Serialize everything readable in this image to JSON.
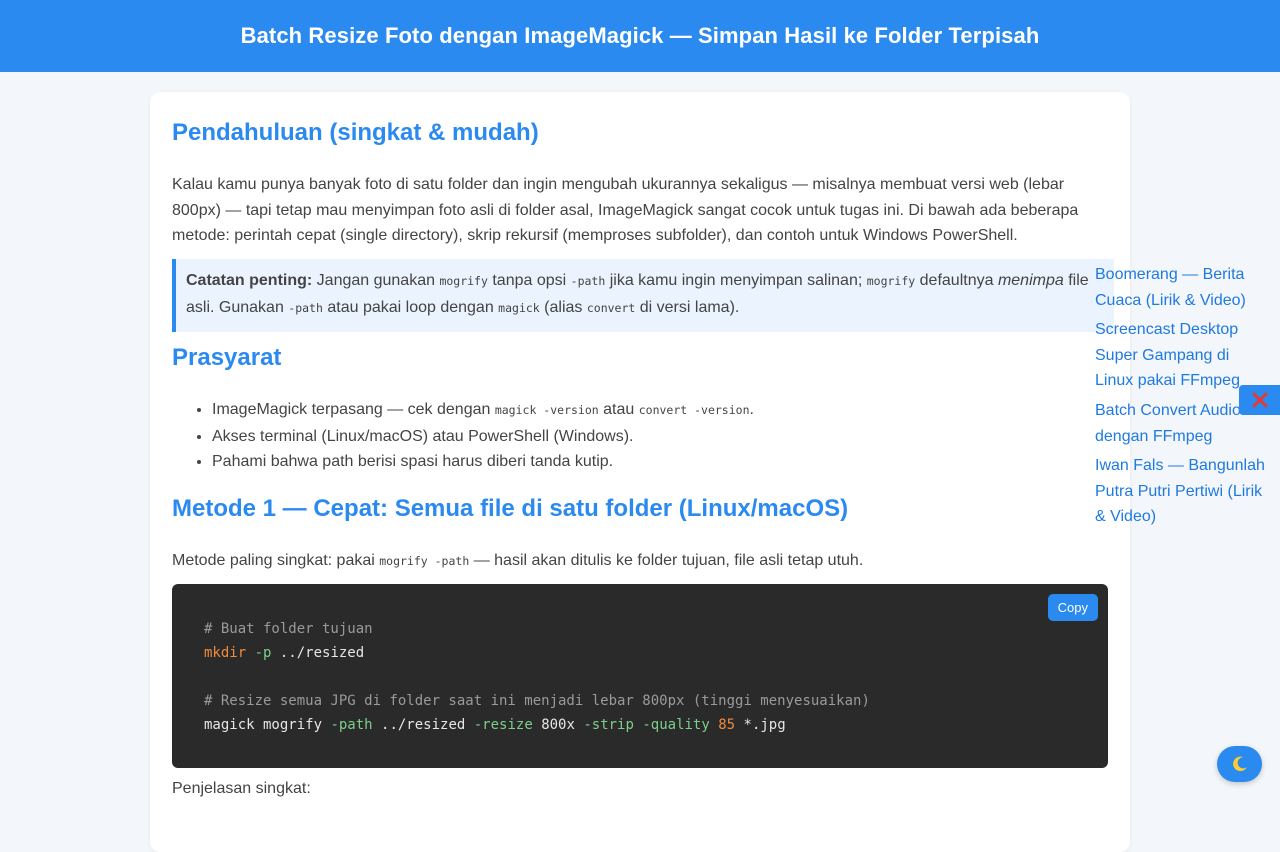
{
  "header": {
    "title": "Batch Resize Foto dengan ImageMagick — Simpan Hasil ke Folder Terpisah"
  },
  "intro": {
    "heading": "Pendahuluan (singkat & mudah)",
    "paragraph": "Kalau kamu punya banyak foto di satu folder dan ingin mengubah ukurannya sekaligus — misalnya membuat versi web (lebar 800px) — tapi tetap mau menyimpan foto asli di folder asal, ImageMagick sangat cocok untuk tugas ini. Di bawah ada beberapa metode: perintah cepat (single directory), skrip rekursif (memproses subfolder), dan contoh untuk Windows PowerShell."
  },
  "note": {
    "label": "Catatan penting:",
    "t1": " Jangan gunakan ",
    "c1": "mogrify",
    "t2": " tanpa opsi ",
    "c2": "-path",
    "t3": " jika kamu ingin menyimpan salinan; ",
    "c3": "mogrify",
    "t4": " defaultnya ",
    "em": "menimpa",
    "t5": " file asli. Gunakan ",
    "c4": "-path",
    "t6": " atau pakai loop dengan ",
    "c5": "magick",
    "t7": " (alias ",
    "c6": "convert",
    "t8": " di versi lama)."
  },
  "prereq": {
    "heading": "Prasyarat",
    "item1_a": "ImageMagick terpasang — cek dengan ",
    "item1_c1": "magick -version",
    "item1_b": " atau ",
    "item1_c2": "convert -version",
    "item1_c": ".",
    "item2": "Akses terminal (Linux/macOS) atau PowerShell (Windows).",
    "item3": "Pahami bahwa path berisi spasi harus diberi tanda kutip."
  },
  "method1": {
    "heading": "Metode 1 — Cepat: Semua file di satu folder (Linux/macOS)",
    "lead_a": "Metode paling singkat: pakai ",
    "lead_code": "mogrify -path",
    "lead_b": " — hasil akan ditulis ke folder tujuan, file asli tetap utuh.",
    "copy_label": "Copy",
    "code": {
      "comment1": "# Buat folder tujuan",
      "cmd1": "mkdir",
      "flag1": "-p",
      "arg1": " ../resized",
      "comment2": "# Resize semua JPG di folder saat ini menjadi lebar 800px (tinggi menyesuaikan)",
      "cmd2": "magick mogrify ",
      "flag2": "-path",
      "arg2": " ../resized ",
      "flag3": "-resize",
      "arg3": " 800x ",
      "flag4": "-strip",
      "sp": " ",
      "flag5": "-quality",
      "sp2": " ",
      "num": "85",
      "arg4": " *.jpg"
    },
    "after": "Penjelasan singkat:"
  },
  "related": [
    "Boomerang — Berita Cuaca (Lirik & Video)",
    "Screencast Desktop Super Gampang di Linux pakai FFmpeg",
    "Batch Convert Audio dengan FFmpeg",
    "Iwan Fals — Bangunlah Putra Putri Pertiwi (Lirik & Video)"
  ],
  "icons": {
    "close": "close-icon",
    "theme": "moon-icon"
  },
  "colors": {
    "accent": "#2b8af0",
    "code_bg": "#2a2a2a"
  }
}
